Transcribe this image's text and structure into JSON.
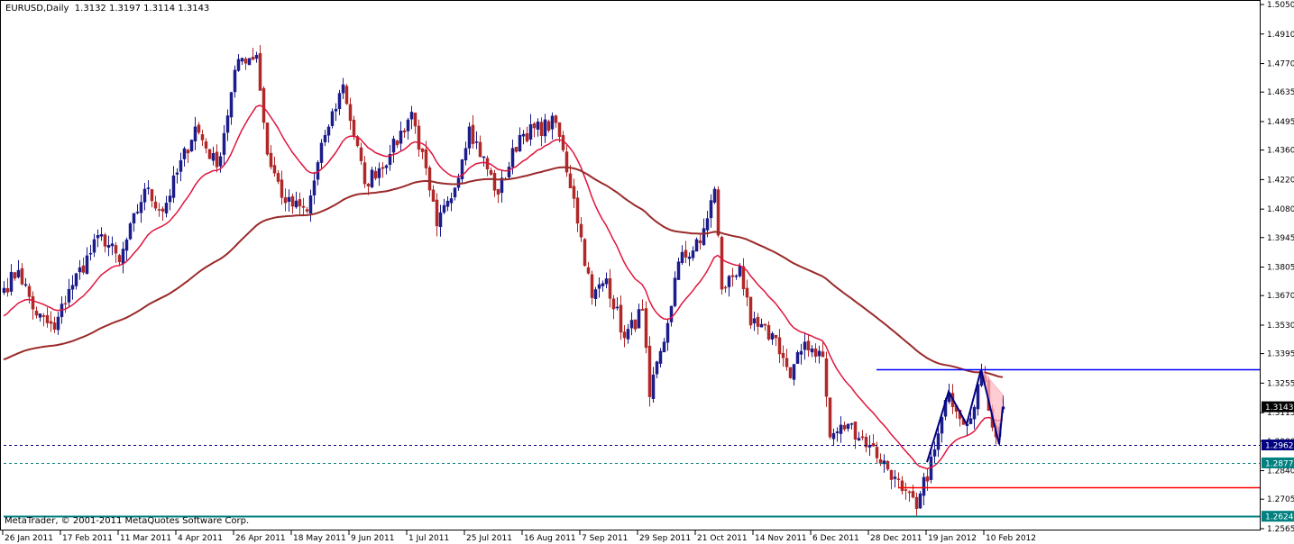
{
  "title": {
    "symbol_tf": "EURUSD,Daily",
    "ohlc": "1.3132 1.3197 1.3114 1.3143"
  },
  "copyright": "MetaTrader, © 2001-2011 MetaQuotes Software Corp.",
  "colors": {
    "bull": "#1c1c8a",
    "bear": "#b02828",
    "ma_fast": "#e0143c",
    "ma_slow": "#9b2a2a",
    "resistance": "#0000ff",
    "support_red": "#ff0000",
    "teal": "#008080",
    "navy": "#000080",
    "pattern": "#000080",
    "pattern_fill": "#ffb6c1"
  },
  "chart_data": {
    "type": "candlestick",
    "symbol": "EURUSD",
    "timeframe": "Daily",
    "ylim": [
      1.2565,
      1.505
    ],
    "y_ticks": [
      "1.5050",
      "1.4910",
      "1.4770",
      "1.4635",
      "1.4495",
      "1.4360",
      "1.4220",
      "1.4080",
      "1.3945",
      "1.3805",
      "1.3670",
      "1.3530",
      "1.3395",
      "1.3255",
      "1.3115",
      "1.2980",
      "1.2840",
      "1.2705",
      "1.2565"
    ],
    "x_ticks": [
      {
        "bar": 0,
        "label": "26 Jan 2011"
      },
      {
        "bar": 16,
        "label": "17 Feb 2011"
      },
      {
        "bar": 32,
        "label": "11 Mar 2011"
      },
      {
        "bar": 48,
        "label": "4 Apr 2011"
      },
      {
        "bar": 64,
        "label": "26 Apr 2011"
      },
      {
        "bar": 80,
        "label": "18 May 2011"
      },
      {
        "bar": 96,
        "label": "9 Jun 2011"
      },
      {
        "bar": 112,
        "label": "1 Jul 2011"
      },
      {
        "bar": 128,
        "label": "25 Jul 2011"
      },
      {
        "bar": 144,
        "label": "16 Aug 2011"
      },
      {
        "bar": 160,
        "label": "7 Sep 2011"
      },
      {
        "bar": 176,
        "label": "29 Sep 2011"
      },
      {
        "bar": 192,
        "label": "21 Oct 2011"
      },
      {
        "bar": 208,
        "label": "14 Nov 2011"
      },
      {
        "bar": 224,
        "label": "6 Dec 2011"
      },
      {
        "bar": 240,
        "label": "28 Dec 2011"
      },
      {
        "bar": 256,
        "label": "19 Jan 2012"
      },
      {
        "bar": 272,
        "label": "10 Feb 2012"
      }
    ],
    "close_path": [
      [
        0,
        1.3705
      ],
      [
        4,
        1.379
      ],
      [
        9,
        1.3577
      ],
      [
        14,
        1.351
      ],
      [
        18,
        1.37
      ],
      [
        27,
        1.396
      ],
      [
        32,
        1.383
      ],
      [
        39,
        1.4175
      ],
      [
        44,
        1.407
      ],
      [
        53,
        1.447
      ],
      [
        59,
        1.428
      ],
      [
        65,
        1.479
      ],
      [
        70,
        1.481
      ],
      [
        73,
        1.434
      ],
      [
        78,
        1.411
      ],
      [
        84,
        1.407
      ],
      [
        89,
        1.443
      ],
      [
        94,
        1.467
      ],
      [
        100,
        1.42
      ],
      [
        107,
        1.434
      ],
      [
        113,
        1.454
      ],
      [
        118,
        1.417
      ],
      [
        120,
        1.4
      ],
      [
        124,
        1.413
      ],
      [
        129,
        1.447
      ],
      [
        137,
        1.415
      ],
      [
        143,
        1.443
      ],
      [
        153,
        1.449
      ],
      [
        158,
        1.413
      ],
      [
        163,
        1.366
      ],
      [
        167,
        1.375
      ],
      [
        172,
        1.347
      ],
      [
        177,
        1.36
      ],
      [
        179,
        1.319
      ],
      [
        183,
        1.345
      ],
      [
        187,
        1.383
      ],
      [
        193,
        1.392
      ],
      [
        197,
        1.4175
      ],
      [
        199,
        1.37
      ],
      [
        204,
        1.381
      ],
      [
        207,
        1.353
      ],
      [
        214,
        1.347
      ],
      [
        218,
        1.328
      ],
      [
        222,
        1.345
      ],
      [
        227,
        1.338
      ],
      [
        229,
        1.3
      ],
      [
        234,
        1.306
      ],
      [
        240,
        1.296
      ],
      [
        247,
        1.281
      ],
      [
        249,
        1.2745
      ],
      [
        253,
        1.266
      ],
      [
        258,
        1.294
      ],
      [
        262,
        1.321
      ],
      [
        267,
        1.306
      ],
      [
        271,
        1.33
      ],
      [
        275,
        1.3
      ],
      [
        277,
        1.3143
      ]
    ],
    "last": {
      "open": 1.3132,
      "high": 1.3197,
      "low": 1.3114,
      "close": 1.3143
    },
    "moving_averages": [
      {
        "name": "fast",
        "period": 20,
        "start": 1.356
      },
      {
        "name": "slow",
        "period": 100,
        "start": 1.336
      }
    ],
    "levels": [
      {
        "name": "resistance",
        "price": 1.332,
        "from_bar": 242,
        "style": "solid",
        "color_key": "resistance"
      },
      {
        "name": "dashed-navy",
        "price": 1.2962,
        "label": "1.2962",
        "from_bar": 0,
        "style": "dashed",
        "color_key": "navy"
      },
      {
        "name": "dashed-teal",
        "price": 1.2877,
        "label": "1.2877",
        "from_bar": 0,
        "style": "dashed",
        "color_key": "teal"
      },
      {
        "name": "support-red",
        "price": 1.276,
        "from_bar": 248,
        "style": "solid",
        "color_key": "support_red"
      },
      {
        "name": "teal-support",
        "price": 1.2624,
        "label": "1.2624",
        "from_bar": 0,
        "style": "solid",
        "color_key": "teal"
      }
    ],
    "current_price_label": "1.3143",
    "pattern_zigzag": [
      [
        256,
        1.288
      ],
      [
        262,
        1.3215
      ],
      [
        267,
        1.306
      ],
      [
        271,
        1.332
      ],
      [
        276,
        1.2965
      ],
      [
        277,
        1.3143
      ]
    ],
    "pattern_triangle": [
      [
        271,
        1.332
      ],
      [
        277,
        1.32
      ],
      [
        276,
        1.2965
      ]
    ]
  }
}
